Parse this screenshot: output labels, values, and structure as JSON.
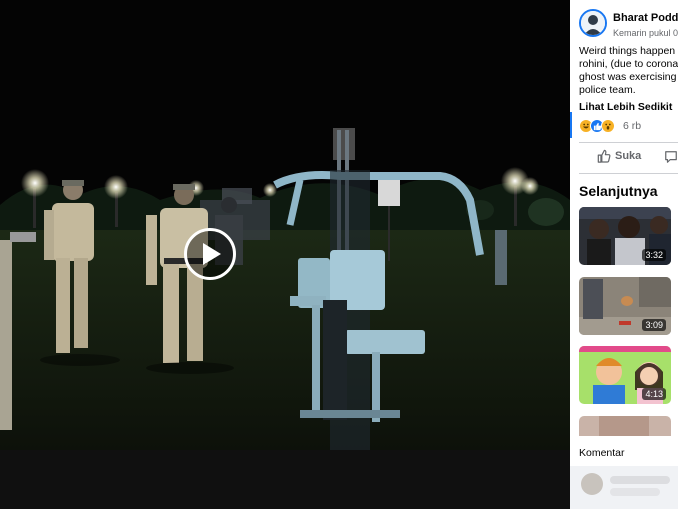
{
  "video": {
    "play_icon": "play-icon"
  },
  "post": {
    "author": "Bharat Poddar",
    "timestamp": "Kemarin pukul 0",
    "text_lines": [
      "Weird things happen",
      "rohini, (due to corona",
      "ghost was exercising",
      "police team."
    ],
    "see_less": "Lihat Lebih Sedikit",
    "reaction_count": "6 rb",
    "reaction_icons": [
      "haha-icon",
      "like-icon",
      "wow-icon"
    ],
    "like_label": "Suka",
    "comment_icon": "comment-icon"
  },
  "up_next": {
    "title": "Selanjutnya",
    "videos": [
      {
        "duration": "3:32"
      },
      {
        "duration": "3:09"
      },
      {
        "duration": "4:13"
      },
      {
        "duration": ""
      }
    ]
  },
  "comments": {
    "label": "Komentar"
  },
  "colors": {
    "accent": "#1877f2",
    "text": "#050505",
    "secondary_text": "#65676b"
  }
}
